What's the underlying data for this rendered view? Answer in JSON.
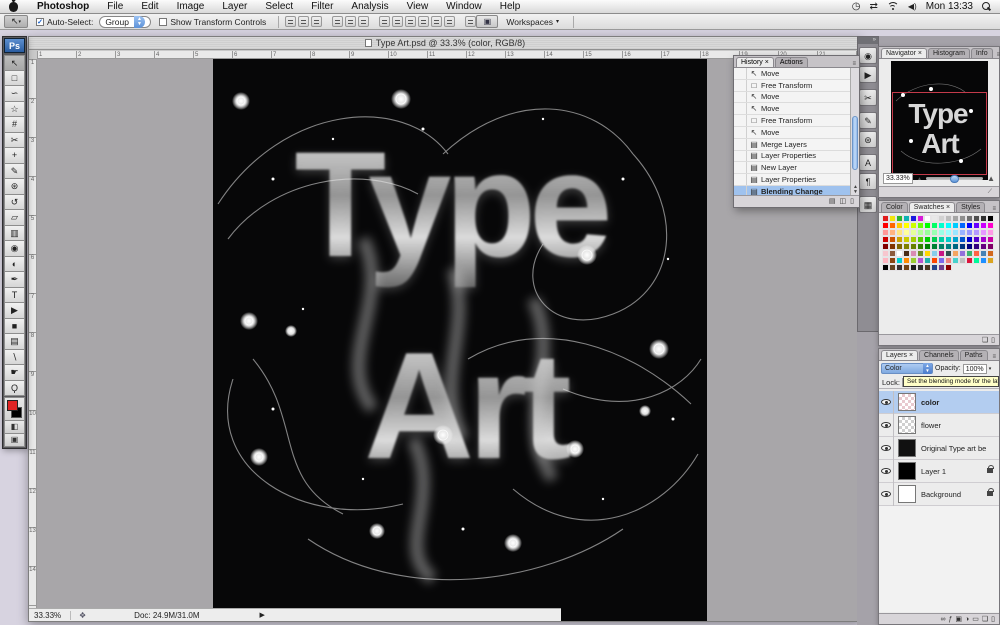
{
  "menu_bar": {
    "items": [
      "Photoshop",
      "File",
      "Edit",
      "Image",
      "Layer",
      "Select",
      "Filter",
      "Analysis",
      "View",
      "Window",
      "Help"
    ],
    "clock_text": "Mon 13:33"
  },
  "options_bar": {
    "auto_select_label": "Auto-Select:",
    "auto_select_checked": "✓",
    "group_value": "Group",
    "show_transform_label": "Show Transform Controls",
    "workspaces_label": "Workspaces",
    "workspaces_arrow": "▾",
    "align_buttons": [
      "align-top",
      "align-vertical-center",
      "align-bottom",
      "align-left",
      "align-horizontal-center",
      "align-right",
      "distribute-top",
      "distribute-vertical-center",
      "distribute-bottom",
      "distribute-left",
      "distribute-horizontal-center",
      "distribute-right",
      "auto-align-layers"
    ]
  },
  "document": {
    "title": "Type Art.psd @ 33.3% (color, RGB/8)",
    "artwork_line1": "Type",
    "artwork_line2": "Art",
    "status_zoom": "33.33%",
    "status_doc": "Doc: 24.9M/31.0M",
    "h_ruler": [
      "1",
      "2",
      "3",
      "4",
      "5",
      "6",
      "7",
      "8",
      "9",
      "10",
      "11",
      "12",
      "13",
      "14",
      "15",
      "16",
      "17",
      "18",
      "19",
      "20",
      "21"
    ],
    "v_ruler": [
      "1",
      "2",
      "3",
      "4",
      "5",
      "6",
      "7",
      "8",
      "9",
      "10",
      "11",
      "12",
      "13",
      "14"
    ]
  },
  "toolbar": {
    "logo": "Ps",
    "tools": [
      {
        "name": "move",
        "glyph": "↖",
        "selected": true
      },
      {
        "name": "rectangular-marquee",
        "glyph": "□"
      },
      {
        "name": "lasso",
        "glyph": "∽"
      },
      {
        "name": "quick-selection",
        "glyph": "☆"
      },
      {
        "name": "crop",
        "glyph": "#"
      },
      {
        "name": "slice",
        "glyph": "✂"
      },
      {
        "name": "healing-brush",
        "glyph": "+"
      },
      {
        "name": "brush",
        "glyph": "✎"
      },
      {
        "name": "clone-stamp",
        "glyph": "⊛"
      },
      {
        "name": "history-brush",
        "glyph": "↺"
      },
      {
        "name": "eraser",
        "glyph": "▱"
      },
      {
        "name": "gradient",
        "glyph": "▥"
      },
      {
        "name": "blur",
        "glyph": "◉"
      },
      {
        "name": "dodge",
        "glyph": "◐"
      },
      {
        "name": "pen",
        "glyph": "✒"
      },
      {
        "name": "type",
        "glyph": "T"
      },
      {
        "name": "path-selection",
        "glyph": "▶"
      },
      {
        "name": "shape",
        "glyph": "■"
      },
      {
        "name": "notes",
        "glyph": "▤"
      },
      {
        "name": "eyedropper",
        "glyph": "∖"
      },
      {
        "name": "hand",
        "glyph": "☛"
      },
      {
        "name": "zoom",
        "glyph": "Ϙ"
      }
    ]
  },
  "dock_icons": [
    {
      "name": "camera-icon",
      "glyph": "◉",
      "gap": false
    },
    {
      "name": "play-actions-icon",
      "glyph": "▶",
      "gap": false
    },
    {
      "name": "tool-presets-icon",
      "glyph": "✂",
      "gap": true
    },
    {
      "name": "brushes-icon",
      "glyph": "✎",
      "gap": true
    },
    {
      "name": "clone-source-icon",
      "glyph": "⊛",
      "gap": false
    },
    {
      "name": "character-icon",
      "glyph": "A",
      "gap": true
    },
    {
      "name": "paragraph-icon",
      "glyph": "¶",
      "gap": false
    },
    {
      "name": "layer-comps-icon",
      "glyph": "▦",
      "gap": true
    }
  ],
  "history_panel": {
    "tabs": [
      {
        "label": "History ×",
        "on": true
      },
      {
        "label": "Actions",
        "on": false
      }
    ],
    "items": [
      {
        "label": "Move",
        "icon": "↖",
        "selected": false
      },
      {
        "label": "Free Transform",
        "icon": "□",
        "selected": false
      },
      {
        "label": "Move",
        "icon": "↖",
        "selected": false
      },
      {
        "label": "Move",
        "icon": "↖",
        "selected": false
      },
      {
        "label": "Free Transform",
        "icon": "□",
        "selected": false
      },
      {
        "label": "Move",
        "icon": "↖",
        "selected": false
      },
      {
        "label": "Merge Layers",
        "icon": "▤",
        "selected": false
      },
      {
        "label": "Layer Properties",
        "icon": "▤",
        "selected": false
      },
      {
        "label": "New Layer",
        "icon": "▤",
        "selected": false
      },
      {
        "label": "Layer Properties",
        "icon": "▤",
        "selected": false
      },
      {
        "label": "Blending Change",
        "icon": "▤",
        "selected": true
      }
    ],
    "buttons": [
      {
        "name": "new-document-from-state-button",
        "glyph": "▤"
      },
      {
        "name": "new-snapshot-button",
        "glyph": "◫"
      },
      {
        "name": "delete-state-button",
        "glyph": "▯"
      }
    ]
  },
  "navigator_panel": {
    "tabs": [
      {
        "label": "Navigator ×",
        "on": true
      },
      {
        "label": "Histogram",
        "on": false
      },
      {
        "label": "Info",
        "on": false
      }
    ],
    "zoom_value": "33.33%"
  },
  "swatches_panel": {
    "tabs": [
      {
        "label": "Color",
        "on": false
      },
      {
        "label": "Swatches ×",
        "on": true
      },
      {
        "label": "Styles",
        "on": false
      }
    ],
    "buttons": [
      {
        "name": "new-swatch-button",
        "glyph": "❏"
      },
      {
        "name": "delete-swatch-button",
        "glyph": "▯"
      }
    ],
    "colors": [
      "#e01b1b",
      "#f2e50c",
      "#2db22d",
      "#0cb2b2",
      "#1b1be0",
      "#d81bd8",
      "#ffffff",
      "#e8e8e8",
      "#d2d2d2",
      "#bcbcbc",
      "#a5a5a5",
      "#8f8f8f",
      "#6f6f6f",
      "#4f4f4f",
      "#2f2f2f",
      "#000000",
      "#ff0000",
      "#ff6600",
      "#ffcc00",
      "#ffff00",
      "#ccff00",
      "#66ff00",
      "#00ff00",
      "#00ff66",
      "#00ffcc",
      "#00ffff",
      "#00ccff",
      "#0066ff",
      "#0000ff",
      "#6600ff",
      "#cc00ff",
      "#ff00cc",
      "#ff9999",
      "#ffb380",
      "#ffe680",
      "#ffff99",
      "#e6ff99",
      "#b3ff99",
      "#99ff99",
      "#99ffb3",
      "#99ffe6",
      "#99ffff",
      "#99e6ff",
      "#99b3ff",
      "#9999ff",
      "#b399ff",
      "#e699ff",
      "#ff99e6",
      "#cc0000",
      "#cc5200",
      "#cca300",
      "#cccc00",
      "#a3cc00",
      "#52cc00",
      "#00cc00",
      "#00cc52",
      "#00cca3",
      "#00cccc",
      "#00a3cc",
      "#0052cc",
      "#0000cc",
      "#5200cc",
      "#a300cc",
      "#cc00a3",
      "#800000",
      "#803300",
      "#806600",
      "#808000",
      "#668000",
      "#338000",
      "#008000",
      "#008033",
      "#008066",
      "#008080",
      "#006680",
      "#003380",
      "#000080",
      "#330080",
      "#660080",
      "#800066",
      "#f7c6ce",
      "#8c5a3c",
      "#ffffff",
      "#4a2d18",
      "#d98cb3",
      "#6b8e23",
      "#ffd700",
      "#87ceeb",
      "#c71585",
      "#2f4f4f",
      "#f4a460",
      "#9370db",
      "#3cb371",
      "#ff6347",
      "#4682b4",
      "#d2691e",
      "#ffb6c1",
      "#8b4513",
      "#00ced1",
      "#ff8c00",
      "#9acd32",
      "#ba55d3",
      "#20b2aa",
      "#ff4500",
      "#7b68ee",
      "#f08080",
      "#48d1cc",
      "#c0c0c0",
      "#dc143c",
      "#00fa9a",
      "#1e90ff",
      "#daa520",
      "#000000",
      "#654321",
      "#3b2f2f",
      "#704214",
      "#1c1c1c",
      "#2e2e2e",
      "#4b3621",
      "#26428b",
      "#713e8d",
      "#8b0000"
    ]
  },
  "layers_panel": {
    "tabs": [
      {
        "label": "Layers ×",
        "on": true
      },
      {
        "label": "Channels",
        "on": false
      },
      {
        "label": "Paths",
        "on": false
      }
    ],
    "blend_mode": "Color",
    "opacity_label": "Opacity:",
    "opacity_value": "100%",
    "lock_label": "Lock:",
    "tooltip": "Set the blending mode for the layer",
    "layers": [
      {
        "name": "color",
        "thumb": "checkerpink",
        "selected": true,
        "locked": false
      },
      {
        "name": "flower",
        "thumb": "checker",
        "selected": false,
        "locked": false
      },
      {
        "name": "Original Type art be",
        "thumb": "art",
        "selected": false,
        "locked": false
      },
      {
        "name": "Layer 1",
        "thumb": "black",
        "selected": false,
        "locked": true
      },
      {
        "name": "Background",
        "thumb": "white",
        "selected": false,
        "locked": true
      }
    ],
    "buttons": [
      {
        "name": "link-layers-button",
        "glyph": "∞"
      },
      {
        "name": "layer-style-button",
        "glyph": "ƒ"
      },
      {
        "name": "add-layer-mask-button",
        "glyph": "▣"
      },
      {
        "name": "adjustment-layer-button",
        "glyph": "◑"
      },
      {
        "name": "new-group-button",
        "glyph": "▭"
      },
      {
        "name": "new-layer-button",
        "glyph": "❏"
      },
      {
        "name": "delete-layer-button",
        "glyph": "▯"
      }
    ]
  }
}
